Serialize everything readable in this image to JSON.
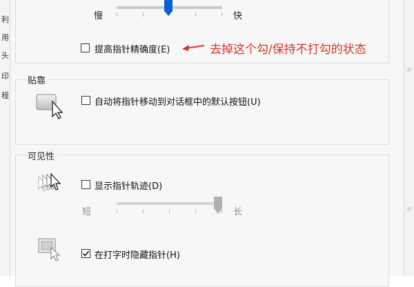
{
  "motion": {
    "speed_slow": "慢",
    "speed_fast": "快",
    "speed_level": 0.47,
    "enhance_precision_label": "提高指针精确度(E)",
    "enhance_precision_checked": false
  },
  "annotation": {
    "text": "去掉这个勾/保持不打勾的状态",
    "color": "#d9342b"
  },
  "snap_to": {
    "title": "贴靠",
    "checkbox_label": "自动将指针移动到对话框中的默认按钮(U)",
    "checked": false
  },
  "visibility": {
    "title": "可见性",
    "trails_label": "显示指针轨迹(D)",
    "trails_checked": false,
    "trail_short": "短",
    "trail_long": "长",
    "trail_level": 1.0,
    "hide_typing_label": "在打字时隐藏指针(H)",
    "hide_typing_checked": true
  },
  "colors": {
    "slider_thumb_active": "#0a5fd8",
    "slider_thumb_disabled": "#b0b0b0"
  },
  "left_strip_chars": [
    "利",
    "用",
    "头",
    "印",
    "程"
  ]
}
